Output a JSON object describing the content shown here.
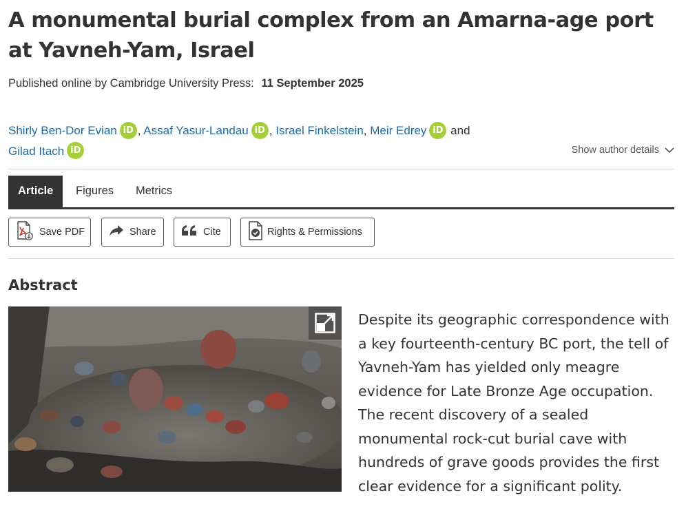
{
  "article": {
    "title": "A monumental burial complex from an Amarna-age port at Yavneh-Yam, Israel",
    "published_label": "Published online by Cambridge University Press:",
    "published_date": "11 September 2025"
  },
  "authors": [
    {
      "name": "Shirly Ben-Dor Evian",
      "orcid": "iD",
      "sep": ","
    },
    {
      "name": "Assaf Yasur-Landau",
      "orcid": "iD",
      "sep": ","
    },
    {
      "name": "Israel Finkelstein",
      "sep": ","
    },
    {
      "name": "Meir Edrey",
      "orcid": "iD",
      "sep": "and"
    },
    {
      "name": "Gilad Itach",
      "orcid": "iD"
    }
  ],
  "show_author_details": "Show author details",
  "tabs": [
    {
      "label": "Article",
      "active": true
    },
    {
      "label": "Figures"
    },
    {
      "label": "Metrics"
    }
  ],
  "actions": {
    "save_pdf": "Save PDF",
    "share": "Share",
    "cite": "Cite",
    "rights": "Rights & Permissions"
  },
  "abstract": {
    "heading": "Abstract",
    "text": "Despite its geographic correspondence with a key fourteenth-century BC port, the tell of Yavneh-Yam has yielded only meagre evidence for Late Bronze Age occupation. The recent discovery of a sealed monumental rock-cut burial cave with hundreds of grave goods provides the first clear evidence for a significant polity."
  },
  "colors": {
    "link": "#1e6aa8",
    "orcid": "#a6ce39",
    "tab_active_bg": "#333333"
  },
  "icons": {
    "save_pdf": "pdf-download-icon",
    "share": "share-arrow-icon",
    "cite": "quote-icon",
    "rights": "document-check-icon",
    "expand": "expand-icon",
    "chevron": "chevron-down-icon"
  }
}
